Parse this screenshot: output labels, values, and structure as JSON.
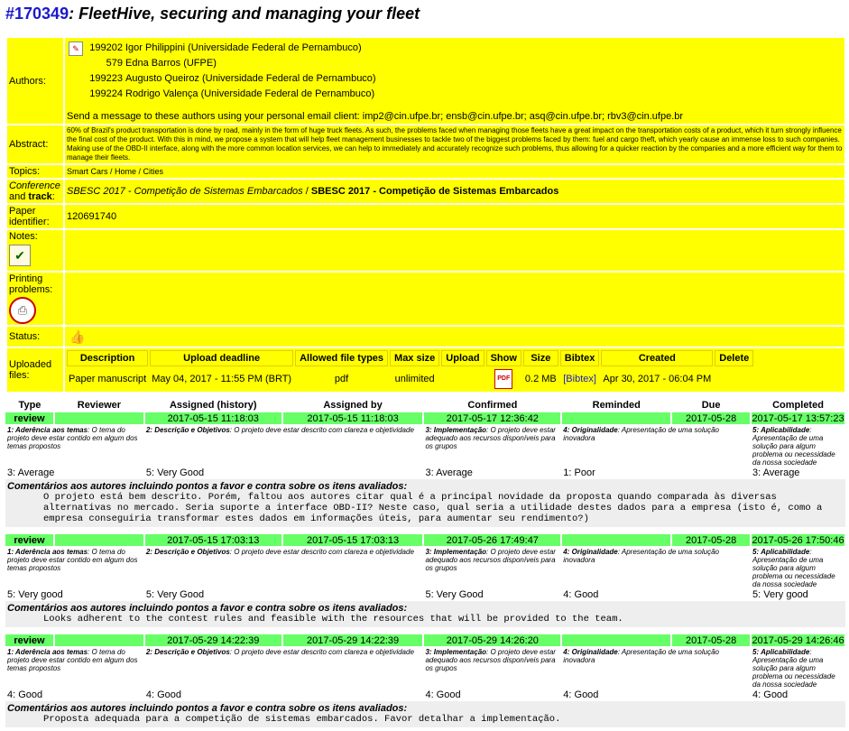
{
  "paper": {
    "number": "#170349",
    "title": ": FleetHive, securing and managing your fleet"
  },
  "labels": {
    "authors": "Authors:",
    "abstract": "Abstract:",
    "topics": "Topics:",
    "conf_a": "Conference",
    "conf_and": "and",
    "conf_track": "track",
    "paper_id": "Paper identifier:",
    "notes": "Notes:",
    "printing": "Printing problems:",
    "status": "Status:",
    "uploaded": "Uploaded files:"
  },
  "authors": [
    {
      "id": "199202",
      "name": "Igor Philippini (Universidade Federal de Pernambuco)"
    },
    {
      "id": "579",
      "name": "Edna Barros (UFPE)"
    },
    {
      "id": "199223",
      "name": "Augusto Queiroz (Universidade Federal de Pernambuco)"
    },
    {
      "id": "199224",
      "name": "Rodrigo Valença (Universidade Federal de Pernambuco)"
    }
  ],
  "message_text": "Send a message to these authors using your personal email client: ",
  "emails": "imp2@cin.ufpe.br; ensb@cin.ufpe.br; asq@cin.ufpe.br; rbv3@cin.ufpe.br",
  "abstract": "60% of Brazil's product transportation is done by road, mainly in the form of huge truck fleets. As such, the problems faced when managing those fleets have a great impact on the transportation costs of a product, which it turn strongly influence the final cost of the product. With this in mind, we propose a system that will help fleet management businesses to tackle two of the biggest problems faced by them: fuel and cargo theft, which yearly cause an immense loss to such companies. Making use of the OBD-II interface, along with the more common location services, we can help to immediately and accurately recognize such problems, thus allowing for a quicker reaction by the companies and a more efficient way for them to manage their fleets.",
  "topics": "Smart Cars / Home / Cities",
  "conference": "SBESC 2017 - Competição de Sistemas Embarcados",
  "track_sep": " / ",
  "track": "SBESC 2017 - Competição de Sistemas Embarcados",
  "paper_identifier": "120691740",
  "icons": {
    "authors": "add-person-icon",
    "notes": "notepad-icon",
    "printing": "printer-prohibited-icon",
    "status": "thumbs-up-icon",
    "pdf": "pdf-file-icon"
  },
  "upload": {
    "headers": [
      "Description",
      "Upload deadline",
      "Allowed file types",
      "Max size",
      "Upload",
      "Show",
      "Size",
      "Bibtex",
      "Created",
      "Delete"
    ],
    "row": {
      "description": "Paper manuscript",
      "deadline": "May 04, 2017 - 11:55 PM (BRT)",
      "types": "pdf",
      "max_size": "unlimited",
      "upload": "",
      "show": "PDF",
      "size": "0.2 MB",
      "bibtex": "[Bibtex]",
      "created": "Apr 30, 2017 - 06:04 PM",
      "delete": ""
    }
  },
  "review_headers": [
    "Type",
    "Reviewer",
    "Assigned (history)",
    "Assigned by",
    "Confirmed",
    "Reminded",
    "Due",
    "Completed"
  ],
  "criteria": [
    {
      "t": "1: Aderência aos temas",
      "d": ": O tema do projeto deve estar contido em algum dos temas propostos"
    },
    {
      "t": "2: Descrição e Objetivos",
      "d": ": O projeto deve estar descrito com clareza e objetividade"
    },
    {
      "t": "3: Implementação",
      "d": ": O projeto deve estar adequado aos recursos disponíveis para os grupos"
    },
    {
      "t": "4: Originalidade",
      "d": ": Apresentação de uma solução inovadora"
    },
    {
      "t": "5: Aplicabilidade",
      "d": ": Apresentação de uma solução para algum problema ou necessidade da nossa sociedade"
    }
  ],
  "comment_header": "Comentários aos autores incluindo pontos a favor e contra sobre os itens avaliados",
  "comment_colon": ":",
  "reviews": [
    {
      "type": "review",
      "reviewer": "",
      "assigned": "2017-05-15 11:18:03",
      "assigned_by": "2017-05-15 11:18:03",
      "confirmed": "2017-05-17 12:36:42",
      "reminded": "",
      "due": "2017-05-28",
      "completed": "2017-05-17 13:57:23",
      "scores": [
        "3: Average",
        "5: Very Good",
        "3: Average",
        "1: Poor",
        "3: Average"
      ],
      "comment": "O projeto está bem descrito. Porém, faltou aos autores citar qual é a principal novidade da proposta quando comparada às diversas alternativas no mercado. Seria suporte a interface OBD-II? Neste caso, qual seria a utilidade destes dados para a empresa (isto é, como a empresa conseguiria transformar estes dados em informações úteis, para aumentar seu rendimento?)"
    },
    {
      "type": "review",
      "reviewer": "",
      "assigned": "2017-05-15 17:03:13",
      "assigned_by": "2017-05-15 17:03:13",
      "confirmed": "2017-05-26 17:49:47",
      "reminded": "",
      "due": "2017-05-28",
      "completed": "2017-05-26 17:50:46",
      "scores": [
        "5: Very good",
        "5: Very Good",
        "5: Very Good",
        "4: Good",
        "5: Very good"
      ],
      "comment": "Looks adherent to the contest rules and feasible with the resources that will be provided to the team."
    },
    {
      "type": "review",
      "reviewer": "",
      "assigned": "2017-05-29 14:22:39",
      "assigned_by": "2017-05-29 14:22:39",
      "confirmed": "2017-05-29 14:26:20",
      "reminded": "",
      "due": "2017-05-28",
      "completed": "2017-05-29 14:26:46",
      "scores": [
        "4: Good",
        "4: Good",
        "4: Good",
        "4: Good",
        "4: Good"
      ],
      "comment": "Proposta adequada para a competição de sistemas embarcados. Favor detalhar a implementação."
    }
  ]
}
